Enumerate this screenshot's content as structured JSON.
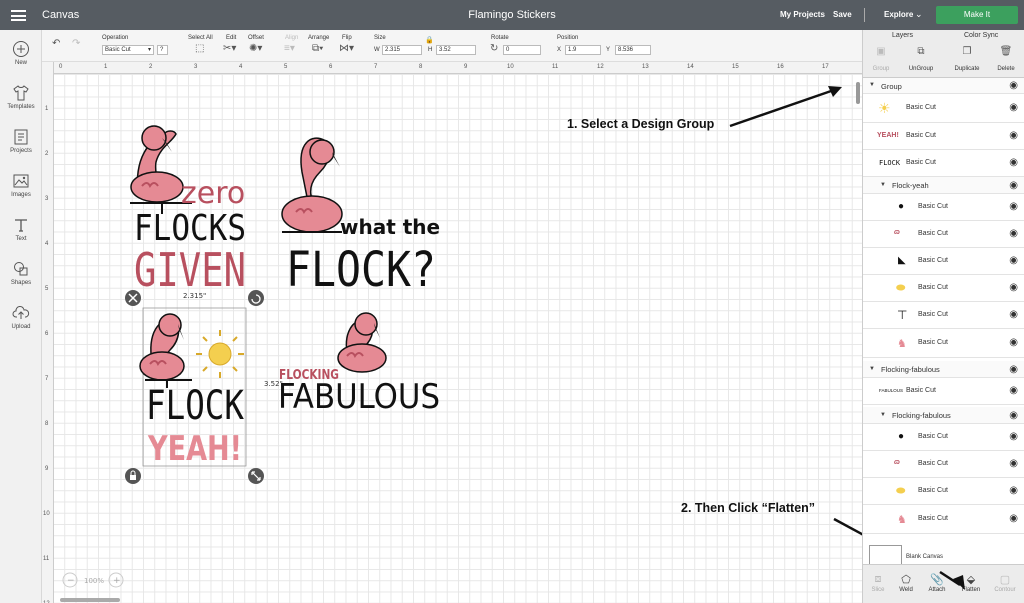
{
  "topbar": {
    "menu_icon": "hamburger-icon",
    "canvas_label": "Canvas",
    "title": "Flamingo Stickers",
    "my_projects": "My Projects",
    "save": "Save",
    "explore": "Explore",
    "make_it": "Make It",
    "accent_color": "#3ca05e",
    "bar_color": "#565c62"
  },
  "leftbar": [
    {
      "label": "New",
      "icon": "plus-circle-icon"
    },
    {
      "label": "Templates",
      "icon": "shirt-icon"
    },
    {
      "label": "Projects",
      "icon": "projects-icon"
    },
    {
      "label": "Images",
      "icon": "image-icon"
    },
    {
      "label": "Text",
      "icon": "text-icon"
    },
    {
      "label": "Shapes",
      "icon": "shapes-icon"
    },
    {
      "label": "Upload",
      "icon": "cloud-upload-icon"
    }
  ],
  "toolbar": {
    "operation_label": "Operation",
    "operation_value": "Basic Cut",
    "help": "?",
    "select_all": "Select All",
    "edit": "Edit",
    "offset": "Offset",
    "align": "Align",
    "arrange": "Arrange",
    "flip": "Flip",
    "size_label": "Size",
    "w_label": "W",
    "w_value": "2.315",
    "h_label": "H",
    "h_value": "3.52",
    "rotate_label": "Rotate",
    "rotate_value": "0",
    "position_label": "Position",
    "x_label": "X",
    "x_value": "1.9",
    "y_label": "Y",
    "y_value": "8.536"
  },
  "ruler": {
    "top": [
      "0",
      "1",
      "2",
      "3",
      "4",
      "5",
      "6",
      "7",
      "8",
      "9",
      "10",
      "11",
      "12",
      "13",
      "14",
      "15",
      "16",
      "17"
    ],
    "left": [
      "1",
      "2",
      "3",
      "4",
      "5",
      "6",
      "7",
      "8",
      "9",
      "10",
      "11",
      "12"
    ]
  },
  "canvas": {
    "designs": {
      "zero_flocks": {
        "line1": "zero",
        "line2": "FLOCKS",
        "line3": "GIVEN"
      },
      "what_the_flock": {
        "line1": "what the",
        "line2": "FLOCK?"
      },
      "flock_yeah": {
        "line1": "FLOCK",
        "line2": "YEAH!"
      },
      "flocking_fabulous": {
        "line1": "FLOCKING",
        "line2": "FABULOUS"
      }
    },
    "width_dim": "2.315\"",
    "height_dim": "3.52\"",
    "zoom": "100%",
    "zoom_minus": "−",
    "zoom_plus": "+"
  },
  "annotations": {
    "step1": "1. Select a Design Group",
    "step2": "2. Then Click “Flatten”"
  },
  "right_panel": {
    "tabs": [
      "Layers",
      "Color Sync"
    ],
    "actions": [
      {
        "label": "Group",
        "icon": "group-icon",
        "enabled": false
      },
      {
        "label": "UnGroup",
        "icon": "ungroup-icon",
        "enabled": true
      },
      {
        "label": "Duplicate",
        "icon": "duplicate-icon",
        "enabled": true
      },
      {
        "label": "Delete",
        "icon": "trash-icon",
        "enabled": true
      }
    ],
    "layers": [
      {
        "type": "group",
        "name": "Group"
      },
      {
        "type": "item",
        "cut": "Basic Cut",
        "thumb": "sun-thumb"
      },
      {
        "type": "item",
        "cut": "Basic Cut",
        "thumb": "yeah-thumb",
        "thumb_text": "YEAH!"
      },
      {
        "type": "item",
        "cut": "Basic Cut",
        "thumb": "flock-thumb",
        "thumb_text": "FLOCK"
      },
      {
        "type": "subgroup",
        "name": "Flock-yeah"
      },
      {
        "type": "subitem",
        "cut": "Basic Cut",
        "thumb": "dot-thumb"
      },
      {
        "type": "subitem",
        "cut": "Basic Cut",
        "thumb": "squiggle-thumb"
      },
      {
        "type": "subitem",
        "cut": "Basic Cut",
        "thumb": "beak-thumb"
      },
      {
        "type": "subitem",
        "cut": "Basic Cut",
        "thumb": "wing-thumb"
      },
      {
        "type": "subitem",
        "cut": "Basic Cut",
        "thumb": "legs-thumb"
      },
      {
        "type": "subitem",
        "cut": "Basic Cut",
        "thumb": "flamingo-thumb"
      },
      {
        "type": "group",
        "name": "Flocking-fabulous"
      },
      {
        "type": "item",
        "cut": "Basic Cut",
        "thumb": "fabulous-thumb",
        "thumb_text": "FABULOUS"
      },
      {
        "type": "subgroup",
        "name": "Flocking-fabulous"
      },
      {
        "type": "subitem",
        "cut": "Basic Cut",
        "thumb": "dot-thumb"
      },
      {
        "type": "subitem",
        "cut": "Basic Cut",
        "thumb": "squiggle-thumb"
      },
      {
        "type": "subitem",
        "cut": "Basic Cut",
        "thumb": "wing-thumb"
      },
      {
        "type": "subitem",
        "cut": "Basic Cut",
        "thumb": "flamingo-thumb"
      }
    ],
    "blank_canvas": "Blank Canvas",
    "bottom_actions": [
      {
        "label": "Slice",
        "icon": "slice-icon",
        "enabled": false
      },
      {
        "label": "Weld",
        "icon": "weld-icon",
        "enabled": true
      },
      {
        "label": "Attach",
        "icon": "attach-icon",
        "enabled": true
      },
      {
        "label": "Flatten",
        "icon": "flatten-icon",
        "enabled": true
      },
      {
        "label": "Contour",
        "icon": "contour-icon",
        "enabled": false
      }
    ]
  },
  "colors": {
    "flamingo_pink": "#e58a94",
    "flamingo_dark": "#b8505f",
    "sun_yellow": "#f4cf4f",
    "text_black": "#111111"
  }
}
